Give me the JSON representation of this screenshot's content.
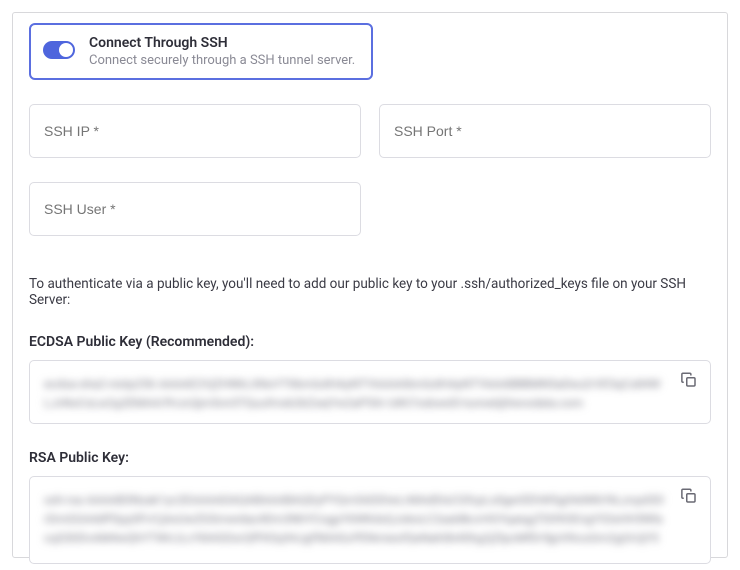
{
  "toggleCard": {
    "title": "Connect Through SSH",
    "subtitle": "Connect securely through a SSH tunnel server.",
    "enabled": true
  },
  "fields": {
    "sshIpPlaceholder": "SSH IP *",
    "sshPortPlaceholder": "SSH Port *",
    "sshUserPlaceholder": "SSH User *"
  },
  "instruction": "To authenticate via a public key, you'll need to add our public key to your .ssh/authorized_keys file on your SSH Server:",
  "keys": {
    "ecdsaLabel": "ECDSA Public Key (Recommended):",
    "ecdsaValue": "ecdsa-sha2-nistp256 AAAAE2VjZHNhLXNoYTItbmlzdHAyNTYAAAAIbmlzdHAyNTYAAABBBMN5aDeu2rVE5qCs84WLJvNoCsLw2g2EMA4/fHJcQjm5nn5TQuufmxb2kZxejYw2aP5Xr-UiKt7odowd3-tunnel@hevodata.com",
    "rsaLabel": "RSA Public Key:",
    "rsaValue": "ssh-rsa AAAAB3Nzak1yc2EAAAADAQABAAABAQDyPYQm5ADDIwLrMAdDIsCGfcpLs0gerEEhW5g04dWbYkLzrqxDDIrDmGGA4dPDpy0FrrCjAxUwZGSmwidaz4Dm3NhYCogpY6WKdsQJokoLC2aaldkcvHGYqaiqgTD09OErigY53sHH5NfacqS3DDvAM4wQhYTWrLILcYbhIGDsrQfFKSq94Jgf9bhIGcPENmieofQeNah0b4Shg2jZlpcMfDr9jpVthcsGm2gOrUjY5a0ioVOFHjFxkqAVKonStS8iKQdhav1M8ImuiKP0kT0qufb1t0uuln290VUaQWHSRtBpBa2PsZG/trf6 tunnel@hevo.io"
  }
}
